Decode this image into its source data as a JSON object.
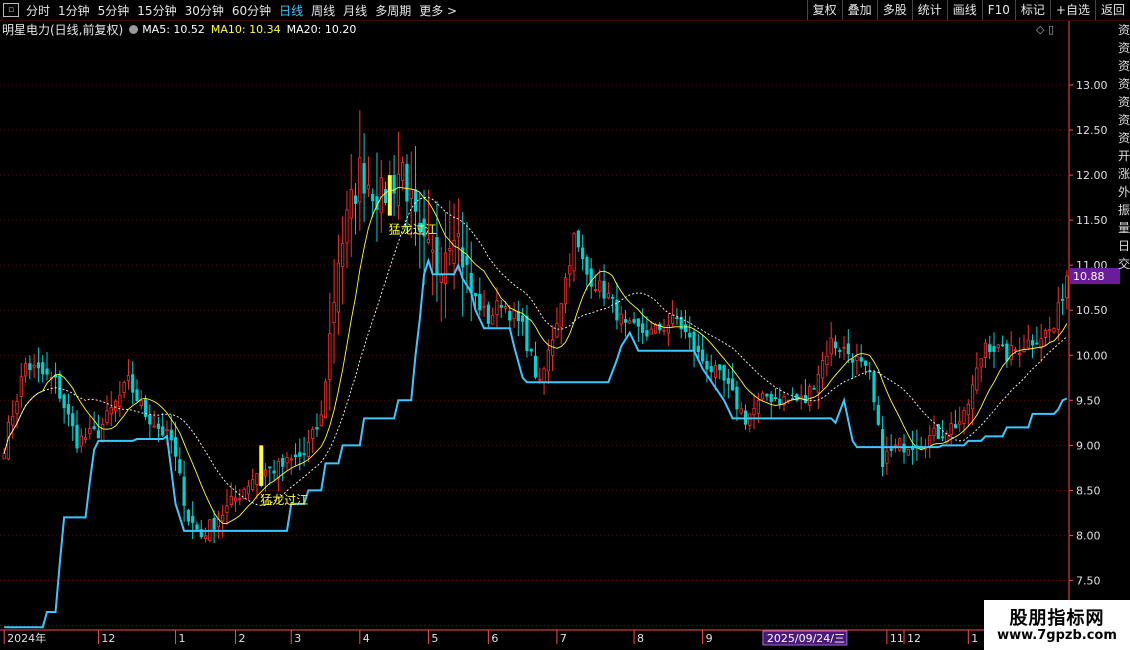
{
  "toolbar": {
    "tabs": [
      "分时",
      "1分钟",
      "5分钟",
      "15分钟",
      "30分钟",
      "60分钟",
      "日线",
      "周线",
      "月线",
      "多周期",
      "更多 >"
    ],
    "active_tab": 6,
    "right_buttons": [
      "复权",
      "叠加",
      "多股",
      "统计",
      "画线",
      "F10",
      "标记",
      "+自选",
      "返回"
    ]
  },
  "info": {
    "title": "明星电力(日线,前复权)",
    "ma5": "MA5: 10.52",
    "ma10": "MA10: 10.34",
    "ma20": "MA20: 10.20"
  },
  "side_text": [
    "资",
    "资",
    "资",
    "资",
    "资",
    "资",
    "资",
    "开",
    "涨",
    "外",
    "振",
    "量",
    "日",
    "交"
  ],
  "watermark": {
    "title": "股朋指标网",
    "url": "www.7gpzb.com"
  },
  "colors": {
    "up": "#ff2e2e",
    "down": "#00d2d2",
    "stop": "#3cc8ff",
    "ma5": "#ffffff",
    "ma10": "#ffff33",
    "ma20": "#ffffff",
    "signal": "#ffff33",
    "grid": "#5a0000",
    "axis": "#ff4a4a",
    "price_tag": "#6a1c9a"
  },
  "chart_data": {
    "type": "candlestick",
    "ylim": [
      6.95,
      13.5
    ],
    "yticks": [
      "7.00",
      "7.50",
      "8.00",
      "8.50",
      "9.00",
      "9.50",
      "10.00",
      "10.50",
      "11.00",
      "11.50",
      "12.00",
      "12.50",
      "13.00"
    ],
    "x_labels": [
      {
        "label": "2024年",
        "i": 0
      },
      {
        "label": "12",
        "i": 22
      },
      {
        "label": "1",
        "i": 40
      },
      {
        "label": "2",
        "i": 54
      },
      {
        "label": "3",
        "i": 67
      },
      {
        "label": "4",
        "i": 83
      },
      {
        "label": "5",
        "i": 99
      },
      {
        "label": "6",
        "i": 113
      },
      {
        "label": "7",
        "i": 129
      },
      {
        "label": "8",
        "i": 147
      },
      {
        "label": "9",
        "i": 163
      },
      {
        "label": "11",
        "i": 206
      },
      {
        "label": "12",
        "i": 210
      },
      {
        "label": "1",
        "i": 225
      }
    ],
    "date_tag": {
      "label": "2025/09/24/三",
      "i": 178
    },
    "last_price": "10.88",
    "signals": [
      {
        "label": "猛龙过江",
        "i": 60,
        "price": 8.55
      },
      {
        "label": "猛龙过江",
        "i": 90,
        "price": 11.55
      }
    ],
    "anchors": [
      [
        0,
        9.0
      ],
      [
        5,
        9.9
      ],
      [
        12,
        9.7
      ],
      [
        17,
        9.05
      ],
      [
        22,
        9.15
      ],
      [
        29,
        9.7
      ],
      [
        33,
        9.35
      ],
      [
        39,
        9.05
      ],
      [
        43,
        8.2
      ],
      [
        46,
        8.0
      ],
      [
        52,
        8.3
      ],
      [
        59,
        8.7
      ],
      [
        64,
        8.75
      ],
      [
        70,
        8.9
      ],
      [
        74,
        9.3
      ],
      [
        78,
        11.1
      ],
      [
        83,
        12.05
      ],
      [
        88,
        11.75
      ],
      [
        93,
        12.1
      ],
      [
        97,
        11.2
      ],
      [
        101,
        11.0
      ],
      [
        105,
        11.5
      ],
      [
        109,
        10.7
      ],
      [
        113,
        10.4
      ],
      [
        116,
        10.6
      ],
      [
        121,
        10.3
      ],
      [
        125,
        9.65
      ],
      [
        129,
        10.4
      ],
      [
        133,
        11.3
      ],
      [
        136,
        10.9
      ],
      [
        141,
        10.65
      ],
      [
        145,
        10.3
      ],
      [
        151,
        10.25
      ],
      [
        157,
        10.4
      ],
      [
        162,
        10.0
      ],
      [
        168,
        9.7
      ],
      [
        173,
        9.3
      ],
      [
        178,
        9.55
      ],
      [
        183,
        9.5
      ],
      [
        187,
        9.5
      ],
      [
        193,
        10.15
      ],
      [
        198,
        10.0
      ],
      [
        202,
        9.75
      ],
      [
        205,
        8.85
      ],
      [
        209,
        9.0
      ],
      [
        214,
        9.05
      ],
      [
        219,
        9.15
      ],
      [
        224,
        9.3
      ],
      [
        229,
        10.15
      ],
      [
        234,
        10.0
      ],
      [
        239,
        10.15
      ],
      [
        245,
        10.3
      ],
      [
        248,
        10.88
      ]
    ],
    "stop_line": [
      [
        0,
        6.98
      ],
      [
        9,
        6.98
      ],
      [
        10,
        7.15
      ],
      [
        12,
        7.15
      ],
      [
        13,
        7.7
      ],
      [
        14,
        8.2
      ],
      [
        19,
        8.2
      ],
      [
        20,
        8.6
      ],
      [
        21,
        8.95
      ],
      [
        22,
        9.05
      ],
      [
        30,
        9.05
      ],
      [
        31,
        9.07
      ],
      [
        37,
        9.07
      ],
      [
        38,
        9.1
      ],
      [
        40,
        8.35
      ],
      [
        42,
        8.05
      ],
      [
        66,
        8.05
      ],
      [
        67,
        8.35
      ],
      [
        70,
        8.35
      ],
      [
        71,
        8.5
      ],
      [
        74,
        8.5
      ],
      [
        75,
        8.8
      ],
      [
        78,
        8.8
      ],
      [
        79,
        9.0
      ],
      [
        83,
        9.0
      ],
      [
        84,
        9.3
      ],
      [
        91,
        9.3
      ],
      [
        92,
        9.5
      ],
      [
        95,
        9.5
      ],
      [
        96,
        10.0
      ],
      [
        97,
        10.4
      ],
      [
        98,
        10.9
      ],
      [
        99,
        11.05
      ],
      [
        100,
        10.9
      ],
      [
        105,
        10.9
      ],
      [
        106,
        11.0
      ],
      [
        107,
        10.85
      ],
      [
        109,
        10.7
      ],
      [
        110,
        10.5
      ],
      [
        112,
        10.3
      ],
      [
        118,
        10.3
      ],
      [
        119,
        10.1
      ],
      [
        121,
        9.75
      ],
      [
        122,
        9.7
      ],
      [
        141,
        9.7
      ],
      [
        143,
        9.95
      ],
      [
        144,
        10.1
      ],
      [
        146,
        10.25
      ],
      [
        148,
        10.05
      ],
      [
        161,
        10.05
      ],
      [
        163,
        9.85
      ],
      [
        168,
        9.5
      ],
      [
        170,
        9.3
      ],
      [
        193,
        9.3
      ],
      [
        194,
        9.25
      ],
      [
        196,
        9.5
      ],
      [
        198,
        9.05
      ],
      [
        199,
        8.98
      ],
      [
        218,
        8.98
      ],
      [
        219,
        9.0
      ],
      [
        224,
        9.0
      ],
      [
        225,
        9.05
      ],
      [
        228,
        9.05
      ],
      [
        229,
        9.1
      ],
      [
        233,
        9.1
      ],
      [
        234,
        9.2
      ],
      [
        239,
        9.2
      ],
      [
        240,
        9.35
      ],
      [
        245,
        9.35
      ],
      [
        246,
        9.4
      ],
      [
        247,
        9.5
      ],
      [
        248,
        9.52
      ]
    ]
  }
}
